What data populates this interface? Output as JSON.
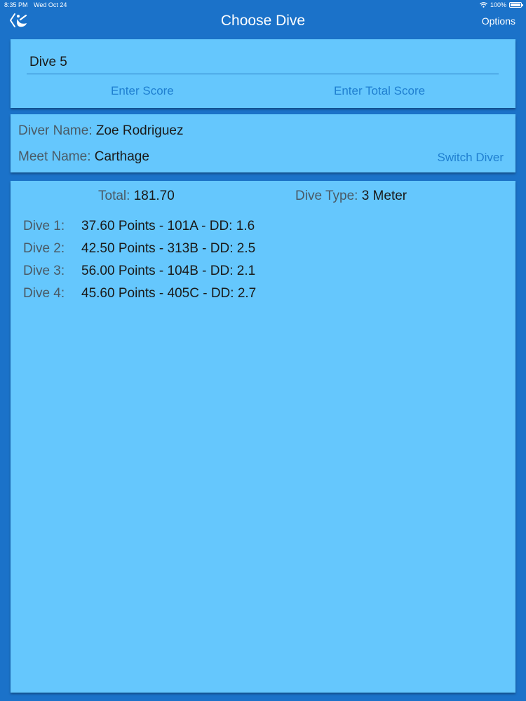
{
  "status_bar": {
    "time": "8:35 PM",
    "date": "Wed Oct 24",
    "battery": "100%",
    "battery_level": 1.0,
    "icons": [
      "wifi-icon",
      "battery-icon"
    ]
  },
  "nav": {
    "title": "Choose Dive",
    "options_label": "Options",
    "back_icon": "back-diver-icon"
  },
  "dive_entry": {
    "dive_value": "Dive 5",
    "enter_score_label": "Enter Score",
    "enter_total_label": "Enter Total Score"
  },
  "diver_info": {
    "diver_name_label": "Diver Name:",
    "diver_name": "Zoe Rodriguez",
    "meet_name_label": "Meet Name:",
    "meet_name": "Carthage",
    "switch_label": "Switch Diver"
  },
  "summary": {
    "total_label": "Total:",
    "total_value": "181.70",
    "type_label": "Dive Type:",
    "type_value": "3 Meter"
  },
  "dives": [
    {
      "label": "Dive 1:",
      "detail": "37.60 Points - 101A - DD: 1.6"
    },
    {
      "label": "Dive 2:",
      "detail": "42.50 Points - 313B - DD: 2.5"
    },
    {
      "label": "Dive 3:",
      "detail": "56.00 Points - 104B - DD: 2.1"
    },
    {
      "label": "Dive 4:",
      "detail": "45.60 Points - 405C - DD: 2.7"
    }
  ],
  "colors": {
    "background": "#1b72c9",
    "card": "#65c7fd",
    "link": "#1f7fd0",
    "label": "#4a5a66",
    "text": "#1a1a1a"
  }
}
